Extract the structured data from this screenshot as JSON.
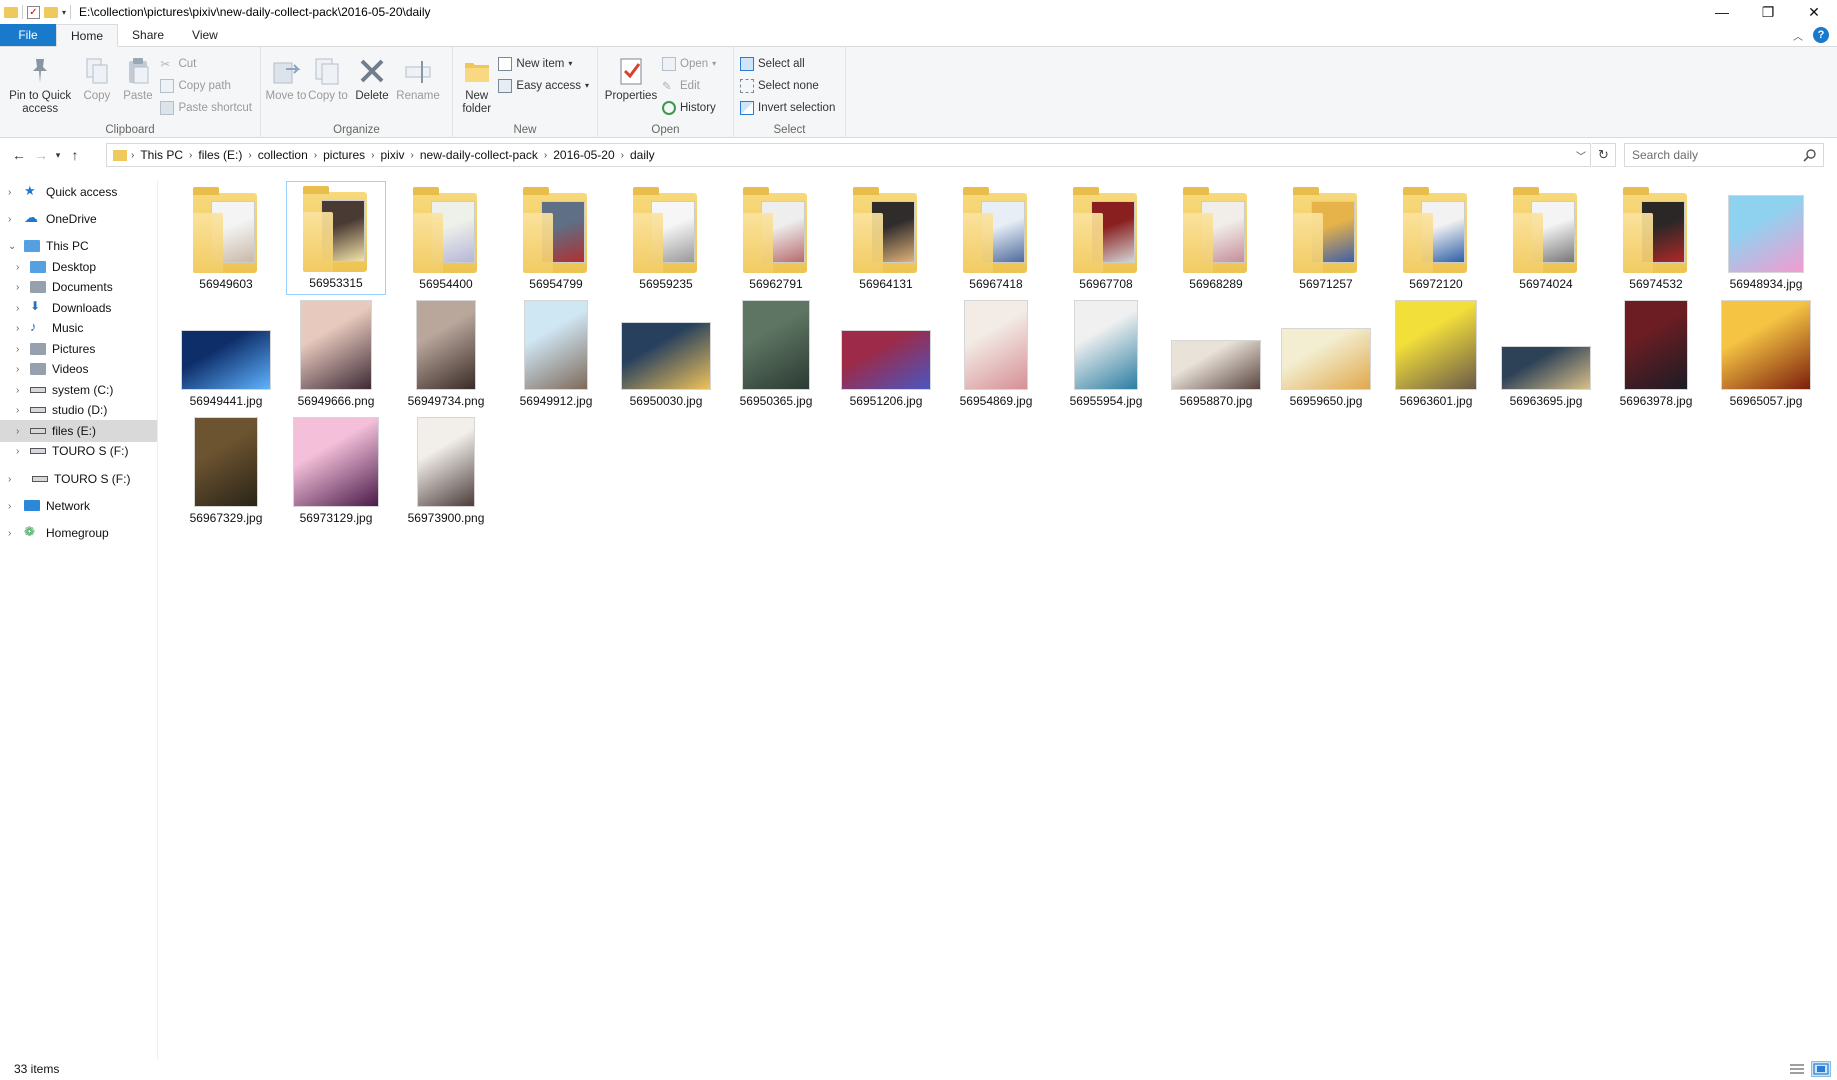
{
  "window": {
    "title": "E:\\collection\\pictures\\pixiv\\new-daily-collect-pack\\2016-05-20\\daily"
  },
  "ribbon_tabs": [
    "File",
    "Home",
    "Share",
    "View"
  ],
  "ribbon": {
    "clipboard": {
      "label": "Clipboard",
      "pin": "Pin to Quick access",
      "copy": "Copy",
      "paste": "Paste",
      "cut": "Cut",
      "copy_path": "Copy path",
      "paste_shortcut": "Paste shortcut"
    },
    "organize": {
      "label": "Organize",
      "move_to": "Move to",
      "copy_to": "Copy to",
      "delete": "Delete",
      "rename": "Rename"
    },
    "new": {
      "label": "New",
      "new_folder": "New folder",
      "new_item": "New item",
      "easy_access": "Easy access"
    },
    "open": {
      "label": "Open",
      "properties": "Properties",
      "open": "Open",
      "edit": "Edit",
      "history": "History"
    },
    "select": {
      "label": "Select",
      "select_all": "Select all",
      "select_none": "Select none",
      "invert": "Invert selection"
    }
  },
  "address": {
    "crumbs": [
      "This PC",
      "files (E:)",
      "collection",
      "pictures",
      "pixiv",
      "new-daily-collect-pack",
      "2016-05-20",
      "daily"
    ],
    "search_placeholder": "Search daily"
  },
  "nav": [
    {
      "label": "Quick access",
      "icon": "star-icon",
      "color": "#1f77d0"
    },
    {
      "label": "OneDrive",
      "icon": "cloud-icon",
      "color": "#1f77d0"
    },
    {
      "label": "This PC",
      "icon": "computer-icon",
      "color": "#2b88d8"
    },
    {
      "label": "Desktop",
      "icon": "desktop-icon",
      "color": "#2b88d8"
    },
    {
      "label": "Documents",
      "icon": "documents-icon",
      "color": "#7a8a99"
    },
    {
      "label": "Downloads",
      "icon": "download-icon",
      "color": "#2b6fb8"
    },
    {
      "label": "Music",
      "icon": "music-icon",
      "color": "#2b6fb8"
    },
    {
      "label": "Pictures",
      "icon": "pictures-icon",
      "color": "#7a8a99"
    },
    {
      "label": "Videos",
      "icon": "videos-icon",
      "color": "#7a8a99"
    },
    {
      "label": "system (C:)",
      "icon": "drive-icon",
      "color": "#555"
    },
    {
      "label": "studio (D:)",
      "icon": "drive-icon",
      "color": "#555"
    },
    {
      "label": "files (E:)",
      "icon": "drive-icon",
      "color": "#555"
    },
    {
      "label": "TOURO S (F:)",
      "icon": "drive-icon",
      "color": "#555"
    },
    {
      "label": "TOURO S (F:)",
      "icon": "drive-icon",
      "color": "#555"
    },
    {
      "label": "Network",
      "icon": "network-icon",
      "color": "#2b88d8"
    },
    {
      "label": "Homegroup",
      "icon": "homegroup-icon",
      "color": "#2a9d4a"
    }
  ],
  "items": [
    {
      "name": "56949603",
      "type": "folder",
      "colors": [
        "#f4f4f4",
        "#c9b9a7"
      ]
    },
    {
      "name": "56953315",
      "type": "folder",
      "colors": [
        "#4a3a34",
        "#f3e3a8"
      ]
    },
    {
      "name": "56954400",
      "type": "folder",
      "colors": [
        "#eef0ea",
        "#b6b6d8"
      ]
    },
    {
      "name": "56954799",
      "type": "folder",
      "colors": [
        "#5e6f86",
        "#b03030"
      ]
    },
    {
      "name": "56959235",
      "type": "folder",
      "colors": [
        "#f6f6f6",
        "#999999"
      ]
    },
    {
      "name": "56962791",
      "type": "folder",
      "colors": [
        "#eeeeee",
        "#b76b6b"
      ]
    },
    {
      "name": "56964131",
      "type": "folder",
      "colors": [
        "#2f2c2b",
        "#e0b27a"
      ]
    },
    {
      "name": "56967418",
      "type": "folder",
      "colors": [
        "#e7eef6",
        "#4f6b9c"
      ]
    },
    {
      "name": "56967708",
      "type": "folder",
      "colors": [
        "#8a1f1f",
        "#d4d4d4"
      ]
    },
    {
      "name": "56968289",
      "type": "folder",
      "colors": [
        "#f1ede8",
        "#c58e9a"
      ]
    },
    {
      "name": "56971257",
      "type": "folder",
      "colors": [
        "#e6b24a",
        "#3f5fa8"
      ]
    },
    {
      "name": "56972120",
      "type": "folder",
      "colors": [
        "#f2f2f2",
        "#2d5fa6"
      ]
    },
    {
      "name": "56974024",
      "type": "folder",
      "colors": [
        "#f4f4f4",
        "#777777"
      ]
    },
    {
      "name": "56974532",
      "type": "folder",
      "colors": [
        "#2c2727",
        "#b02828"
      ]
    },
    {
      "name": "56948934.jpg",
      "type": "image",
      "w": 76,
      "h": 78,
      "colors": [
        "#8fd2f0",
        "#f39bcf"
      ]
    },
    {
      "name": "56949441.jpg",
      "type": "image",
      "w": 90,
      "h": 60,
      "colors": [
        "#0e2e6a",
        "#5fb3ff"
      ]
    },
    {
      "name": "56949666.png",
      "type": "image",
      "w": 72,
      "h": 90,
      "colors": [
        "#e8c9bd",
        "#3d2a36"
      ]
    },
    {
      "name": "56949734.png",
      "type": "image",
      "w": 60,
      "h": 90,
      "colors": [
        "#b9a79c",
        "#3a2b27"
      ]
    },
    {
      "name": "56949912.jpg",
      "type": "image",
      "w": 64,
      "h": 90,
      "colors": [
        "#cfe6f3",
        "#7e6a5b"
      ]
    },
    {
      "name": "56950030.jpg",
      "type": "image",
      "w": 90,
      "h": 68,
      "colors": [
        "#27405e",
        "#f0c25a"
      ]
    },
    {
      "name": "56950365.jpg",
      "type": "image",
      "w": 68,
      "h": 90,
      "colors": [
        "#5e7563",
        "#2b3a33"
      ]
    },
    {
      "name": "56951206.jpg",
      "type": "image",
      "w": 90,
      "h": 60,
      "colors": [
        "#9c2a48",
        "#4a56c2"
      ]
    },
    {
      "name": "56954869.jpg",
      "type": "image",
      "w": 64,
      "h": 90,
      "colors": [
        "#f3ece6",
        "#d68f95"
      ]
    },
    {
      "name": "56955954.jpg",
      "type": "image",
      "w": 64,
      "h": 90,
      "colors": [
        "#f0f0f0",
        "#2a7ea2"
      ]
    },
    {
      "name": "56958870.jpg",
      "type": "image",
      "w": 90,
      "h": 50,
      "colors": [
        "#e9e2d9",
        "#5a4540"
      ]
    },
    {
      "name": "56959650.jpg",
      "type": "image",
      "w": 90,
      "h": 62,
      "colors": [
        "#f3eed2",
        "#e0a84a"
      ]
    },
    {
      "name": "56963601.jpg",
      "type": "image",
      "w": 82,
      "h": 90,
      "colors": [
        "#f3df3a",
        "#6a5a48"
      ]
    },
    {
      "name": "56963695.jpg",
      "type": "image",
      "w": 90,
      "h": 44,
      "colors": [
        "#2e4257",
        "#d9c089"
      ]
    },
    {
      "name": "56963978.jpg",
      "type": "image",
      "w": 64,
      "h": 90,
      "colors": [
        "#6b1d23",
        "#1c1c24"
      ]
    },
    {
      "name": "56965057.jpg",
      "type": "image",
      "w": 90,
      "h": 90,
      "colors": [
        "#f5c443",
        "#7c1e0c"
      ]
    },
    {
      "name": "56967329.jpg",
      "type": "image",
      "w": 64,
      "h": 90,
      "colors": [
        "#6d5430",
        "#2a2418"
      ]
    },
    {
      "name": "56973129.jpg",
      "type": "image",
      "w": 86,
      "h": 90,
      "colors": [
        "#f3bfd9",
        "#4a1b4a"
      ]
    },
    {
      "name": "56973900.png",
      "type": "image",
      "w": 58,
      "h": 90,
      "colors": [
        "#f2eeea",
        "#4b3d3a"
      ]
    }
  ],
  "selected_item": "56953315",
  "status": {
    "count": "33 items"
  }
}
